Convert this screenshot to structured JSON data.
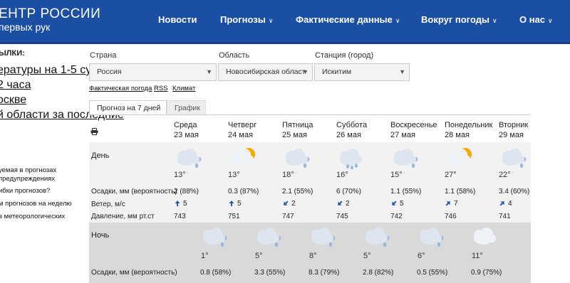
{
  "header": {
    "brand_line1": "ЕНТР РОССИИ",
    "brand_line2": "первых рук",
    "nav": [
      {
        "label": "Новости",
        "dropdown": false
      },
      {
        "label": "Прогнозы",
        "dropdown": true
      },
      {
        "label": "Фактические данные",
        "dropdown": true
      },
      {
        "label": "Вокруг погоды",
        "dropdown": true
      },
      {
        "label": "О нас",
        "dropdown": true
      }
    ]
  },
  "sidebar": {
    "title": "ЫЛКИ:",
    "links": [
      "ературы на 1-5 суток",
      "2 часа",
      "оскве",
      "й области за последние"
    ],
    "links2": [
      "уемая в прогнозах",
      "предупреждениях",
      "ибки прогнозов?",
      "м прогнозов на неделю",
      "в метеорологических"
    ]
  },
  "filters": {
    "country_label": "Страна",
    "country_value": "Россия",
    "region_label": "Область",
    "region_value": "Новосибирская област",
    "station_label": "Станция (город)",
    "station_value": "Искитим"
  },
  "links": [
    "Фактическая погода",
    "RSS",
    "Климат"
  ],
  "tabs": [
    "Прогноз на 7 дней",
    "График"
  ],
  "row_labels": {
    "day": "День",
    "precip": "Осадки, мм (вероятность)",
    "wind": "Ветер, м/с",
    "pressure": "Давление, мм рт.ст",
    "night": "Ночь",
    "night_precip": "Осадки, мм (вероятность)"
  },
  "days": [
    {
      "name": "Среда",
      "date": "23 мая",
      "day_icon": "cloud-rain-icon",
      "temp": "13°",
      "precip": "2 (88%)",
      "wind": "5",
      "wind_dir": "north",
      "pressure": "743",
      "night_icon": "cloud-rain-icon",
      "night_temp": "1°",
      "night_precip": "0.8 (58%)"
    },
    {
      "name": "Четверг",
      "date": "24 мая",
      "day_icon": "partly-cloudy-sun-icon",
      "temp": "13°",
      "precip": "0.3 (87%)",
      "wind": "5",
      "wind_dir": "north",
      "pressure": "751",
      "night_icon": "cloud-rain-icon",
      "night_temp": "5°",
      "night_precip": "3.3 (55%)"
    },
    {
      "name": "Пятница",
      "date": "25 мая",
      "day_icon": "cloud-rain-icon",
      "temp": "18°",
      "precip": "2.1 (55%)",
      "wind": "2",
      "wind_dir": "southwest",
      "pressure": "747",
      "night_icon": "cloud-rain-icon",
      "night_temp": "8°",
      "night_precip": "8.3 (79%)"
    },
    {
      "name": "Суббота",
      "date": "26 мая",
      "day_icon": "cloud-heavy-rain-icon",
      "temp": "16°",
      "precip": "6 (70%)",
      "wind": "2",
      "wind_dir": "southwest",
      "pressure": "745",
      "night_icon": "cloud-rain-icon",
      "night_temp": "5°",
      "night_precip": "2.8 (82%)"
    },
    {
      "name": "Воскресенье",
      "date": "27 мая",
      "day_icon": "cloud-rain-icon",
      "temp": "15°",
      "precip": "1.1 (55%)",
      "wind": "5",
      "wind_dir": "southwest",
      "pressure": "742",
      "night_icon": "cloud-rain-icon",
      "night_temp": "6°",
      "night_precip": "0.5 (55%)"
    },
    {
      "name": "Понедельник",
      "date": "28 мая",
      "day_icon": "partly-cloudy-sun-icon",
      "temp": "27°",
      "precip": "1.1 (58%)",
      "wind": "7",
      "wind_dir": "northeast",
      "pressure": "746",
      "night_icon": "partly-cloudy-moon-icon",
      "night_temp": "11°",
      "night_precip": "0.9 (75%)"
    },
    {
      "name": "Вторник",
      "date": "29 мая",
      "day_icon": "cloud-rain-icon",
      "temp": "22°",
      "precip": "3.4 (60%)",
      "wind": "4",
      "wind_dir": "northeast",
      "pressure": "741",
      "night_icon": "",
      "night_temp": "",
      "night_precip": ""
    }
  ],
  "colors": {
    "header_bg": "#1b4fa3",
    "wind_arrow": "#2b5ca8",
    "sun": "#f2a900",
    "cloud": "#dfe5ee"
  }
}
